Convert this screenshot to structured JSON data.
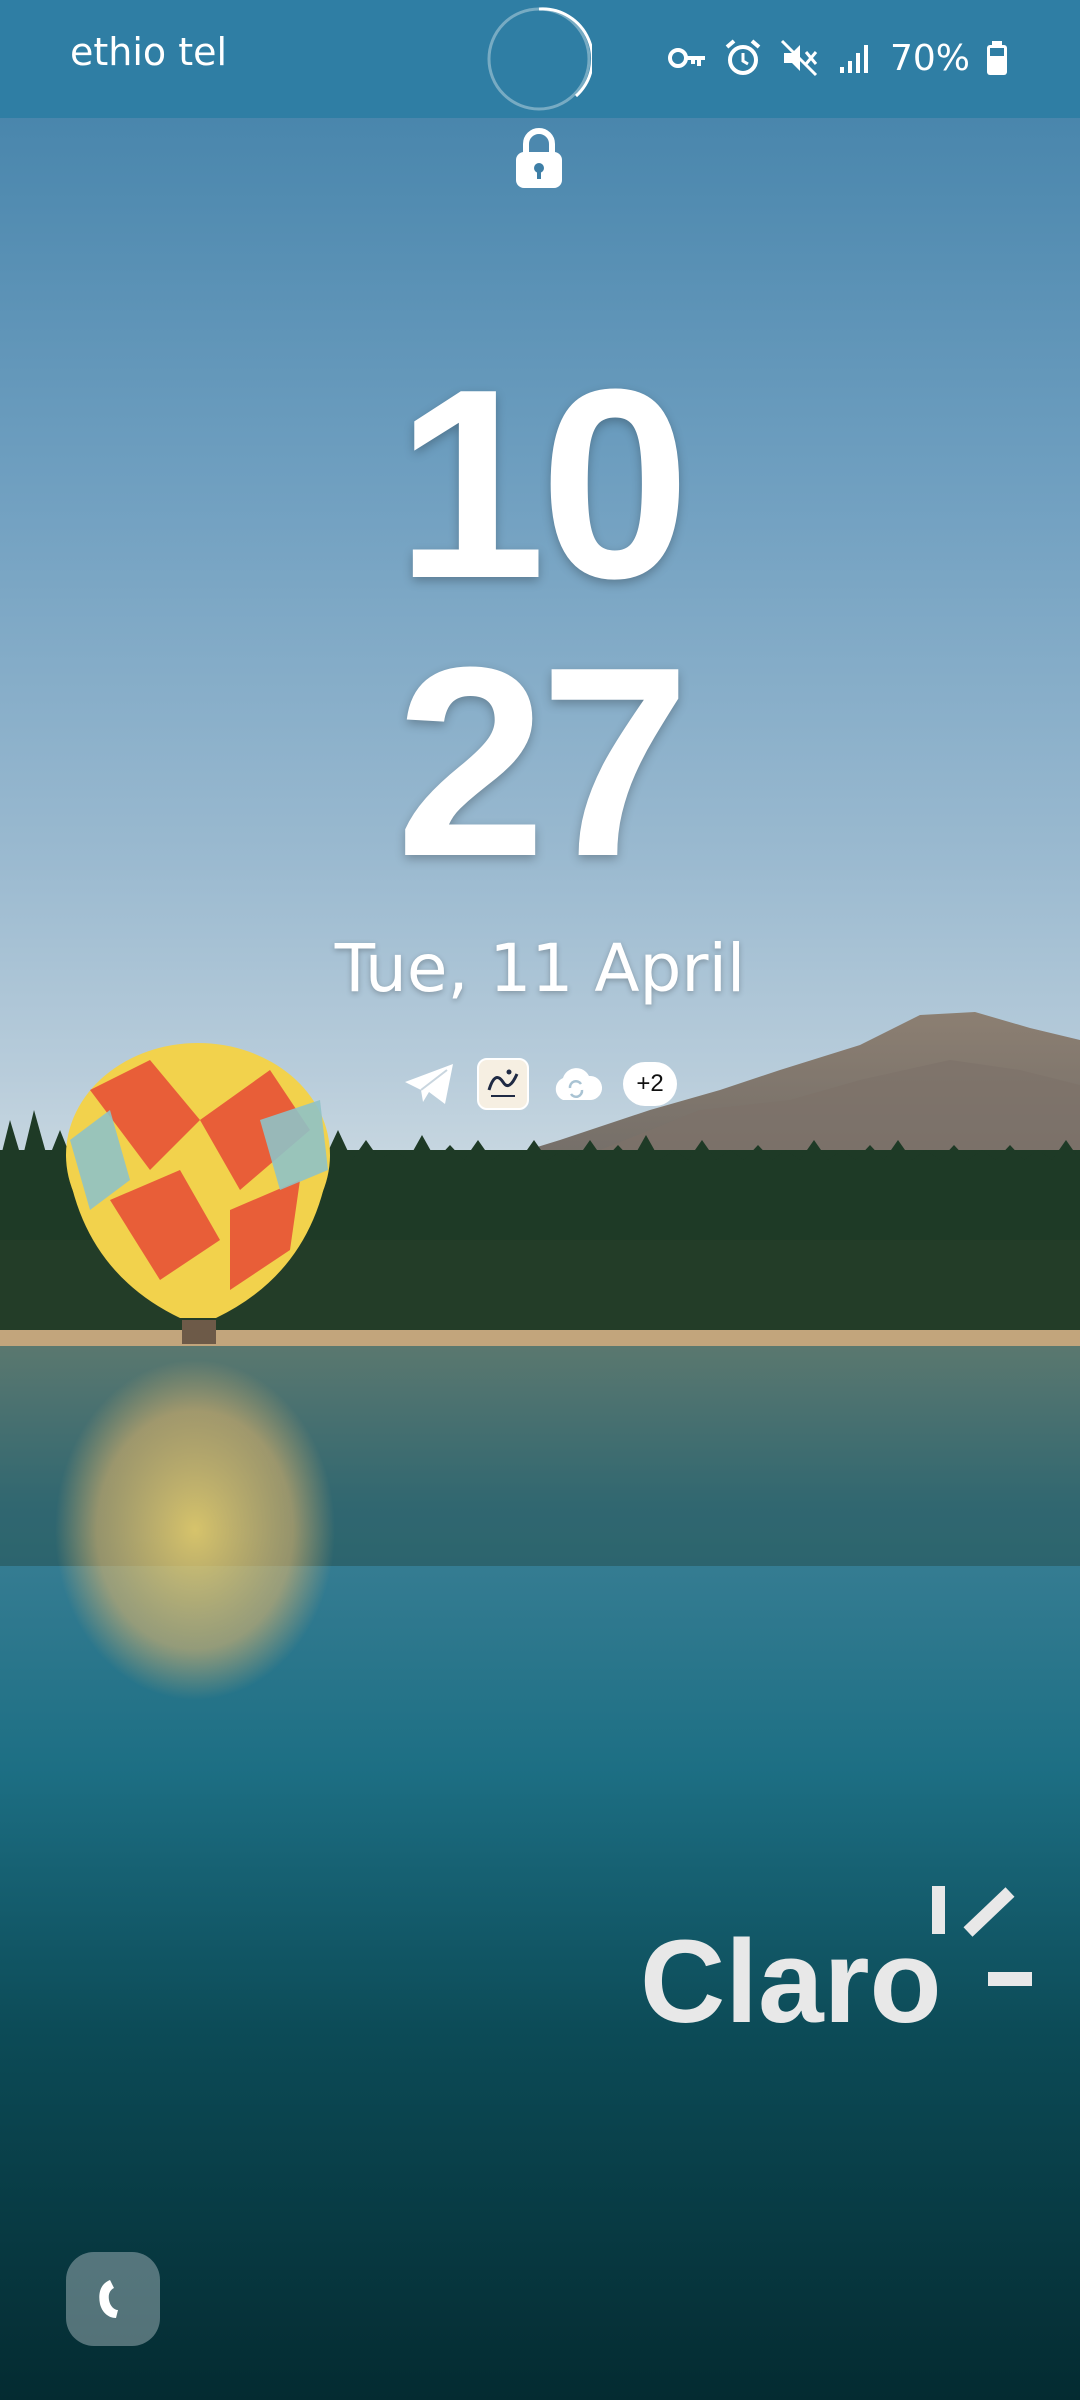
{
  "status_bar": {
    "carrier": "ethio tel",
    "battery_percent": "70%",
    "icons": [
      "vpn-key-icon",
      "alarm-icon",
      "mute-icon",
      "signal-icon",
      "battery-icon"
    ]
  },
  "lock_screen": {
    "lock_icon": "lock-icon",
    "clock": {
      "hour": "10",
      "minute": "27"
    },
    "date": "Tue, 11 April",
    "notifications": {
      "icons": [
        "telegram-icon",
        "app-icon",
        "cloud-sync-icon"
      ],
      "more_count": "+2"
    },
    "watermark": "Claro",
    "shortcut": "phone-icon"
  },
  "colors": {
    "status_bar_bg": "#2f7ea4",
    "text": "#ffffff",
    "watermark": "#e8e8e8"
  }
}
